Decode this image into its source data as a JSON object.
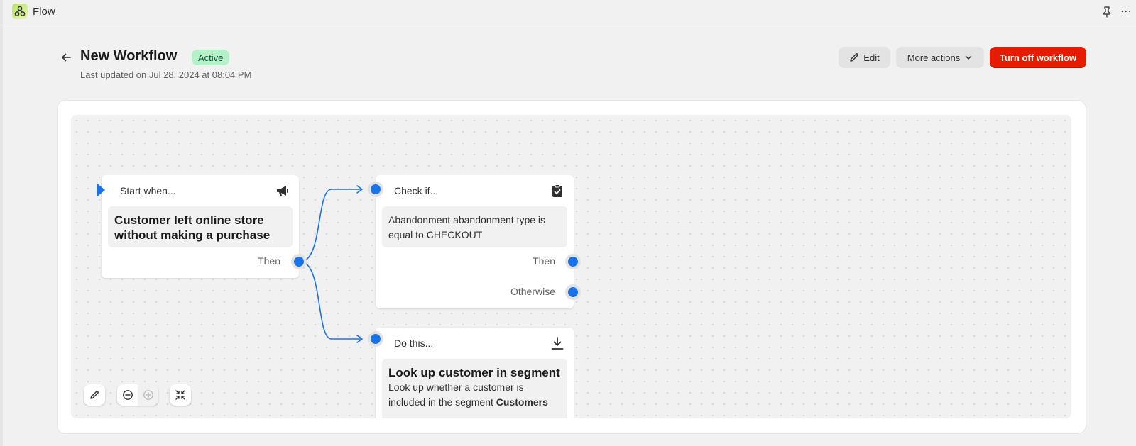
{
  "app": {
    "name": "Flow"
  },
  "header": {
    "title": "New Workflow",
    "status": "Active",
    "last_updated": "Last updated on Jul 28, 2024 at 08:04 PM",
    "edit_label": "Edit",
    "more_actions_label": "More actions",
    "turn_off_label": "Turn off workflow"
  },
  "nodes": {
    "trigger": {
      "kind": "Start when...",
      "title": "Customer left online store without making a purchase",
      "then_label": "Then",
      "icon": "megaphone-icon"
    },
    "condition": {
      "kind": "Check if...",
      "text": "Abandonment abandonment type is equal to CHECKOUT",
      "then_label": "Then",
      "otherwise_label": "Otherwise",
      "icon": "clipboard-check-icon"
    },
    "action": {
      "kind": "Do this...",
      "title": "Look up customer in segment",
      "text_prefix": "Look up whether a customer is included in the segment ",
      "text_bold": "Customers",
      "icon": "download-icon"
    }
  },
  "colors": {
    "accent": "#1a73e8",
    "danger": "#e51c00",
    "badge_bg": "#b4f1c8",
    "badge_text": "#0c5132"
  }
}
